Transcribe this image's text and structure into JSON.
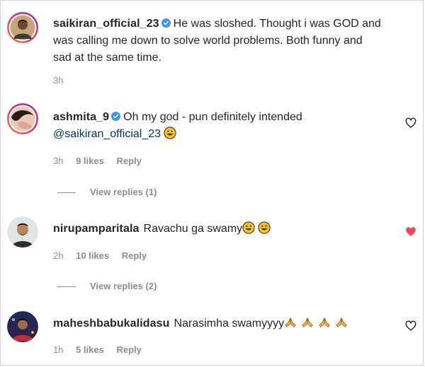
{
  "comments": [
    {
      "username": "saikiran_official_23",
      "verified": true,
      "text": "He was sloshed. Thought i was GOD and was calling me down to solve world problems. Both funny and sad at the same time.",
      "time": "3h"
    },
    {
      "username": "ashmita_9",
      "verified": true,
      "text": "Oh my god - pun definitely intended",
      "mention": "@saikiran_official_23",
      "time": "3h",
      "likes": "9 likes",
      "reply": "Reply",
      "view_replies": "View replies (1)",
      "liked": false
    },
    {
      "username": "nirupamparitala",
      "verified": false,
      "text": "Ravachu ga swamy",
      "time": "2h",
      "likes": "10 likes",
      "reply": "Reply",
      "view_replies": "View replies (2)",
      "liked": true
    },
    {
      "username": "maheshbabukalidasu",
      "verified": false,
      "text": "Narasimha swamyyyy",
      "time": "1h",
      "likes": "5 likes",
      "reply": "Reply",
      "liked": false
    }
  ],
  "icons": {
    "verified": "verified-badge-icon",
    "heart_outline": "heart-outline-icon",
    "heart_filled": "heart-filled-icon",
    "emoji_grin": "grinning-face-icon",
    "emoji_pray": "folded-hands-icon"
  },
  "colors": {
    "verified": "#3897f0",
    "liked": "#ed4956",
    "meta": "#8e8e8e",
    "text": "#262626"
  }
}
